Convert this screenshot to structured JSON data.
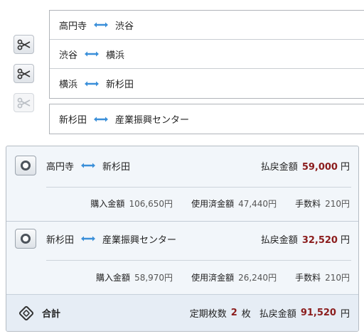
{
  "routes": [
    {
      "from": "高円寺",
      "to": "渋谷"
    },
    {
      "from": "渋谷",
      "to": "横浜"
    },
    {
      "from": "横浜",
      "to": "新杉田"
    }
  ],
  "merged_route": {
    "from": "新杉田",
    "to": "産業振興センター"
  },
  "sections": [
    {
      "from": "高円寺",
      "to": "新杉田",
      "refund_label": "払戻金額",
      "refund_value": "59,000",
      "refund_unit": "円",
      "purchase_label": "購入金額",
      "purchase_value": "106,650円",
      "used_label": "使用済金額",
      "used_value": "47,440円",
      "fee_label": "手数料",
      "fee_value": "210円"
    },
    {
      "from": "新杉田",
      "to": "産業振興センター",
      "refund_label": "払戻金額",
      "refund_value": "32,520",
      "refund_unit": "円",
      "purchase_label": "購入金額",
      "purchase_value": "58,970円",
      "used_label": "使用済金額",
      "used_value": "26,240円",
      "fee_label": "手数料",
      "fee_value": "210円"
    }
  ],
  "total": {
    "label": "合計",
    "count_label": "定期枚数",
    "count_value": "2",
    "count_unit": "枚",
    "refund_label": "払戻金額",
    "refund_value": "91,520",
    "refund_unit": "円"
  },
  "colors": {
    "arrow": "#3a8fd9",
    "refund": "#8b1c1c",
    "panel": "#f2f6fa"
  }
}
